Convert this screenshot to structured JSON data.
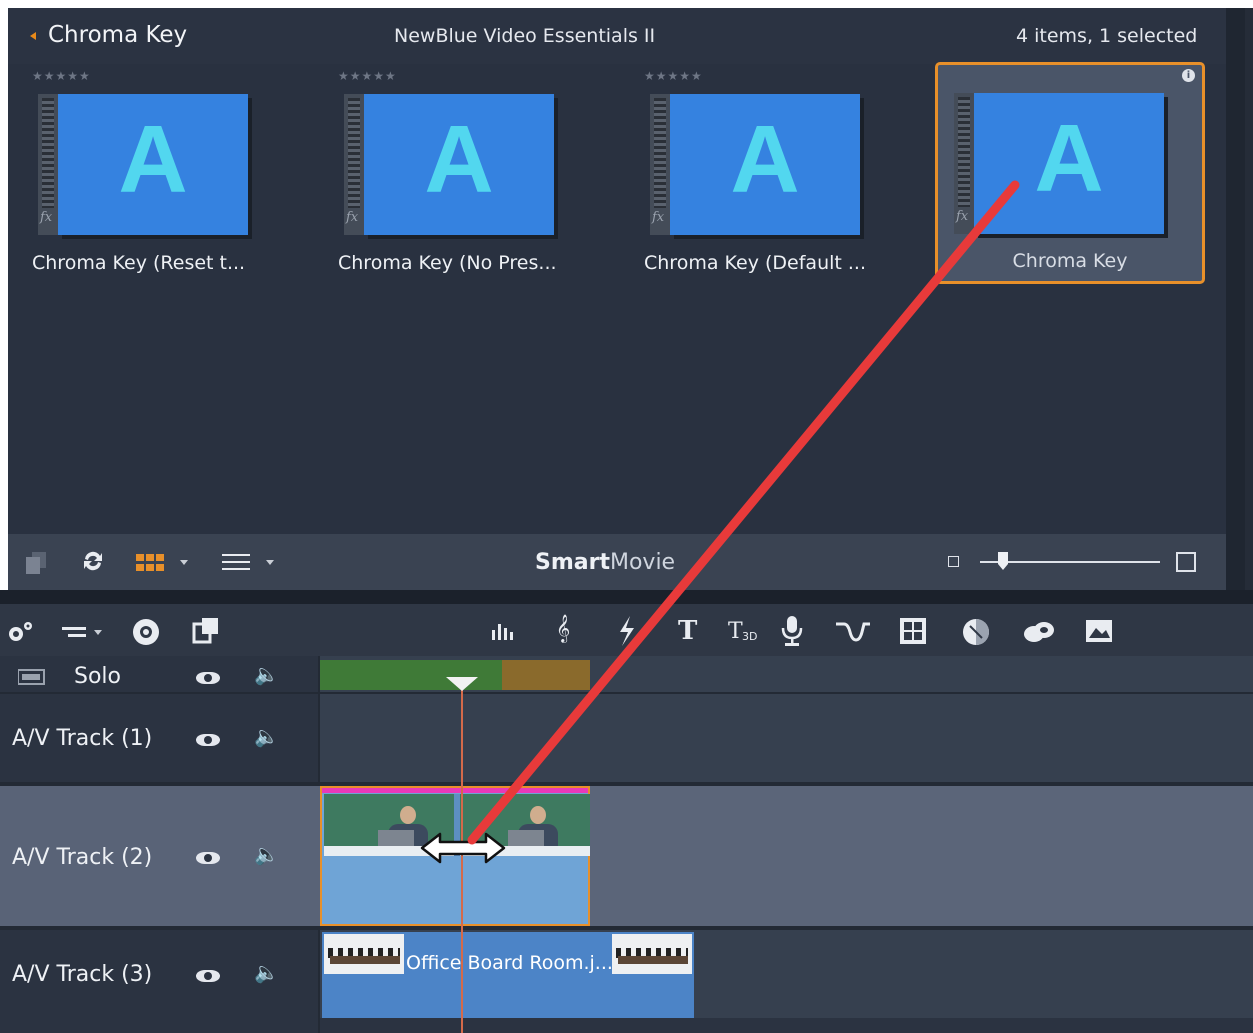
{
  "library": {
    "title": "Chroma Key",
    "category": "NewBlue Video Essentials II",
    "count": "4 items, 1 selected",
    "items": [
      {
        "label": "Chroma Key (Reset t...",
        "letter": "A",
        "selected": false
      },
      {
        "label": "Chroma Key (No Pres...",
        "letter": "A",
        "selected": false
      },
      {
        "label": "Chroma Key (Default ...",
        "letter": "A",
        "selected": false
      },
      {
        "label": "Chroma Key",
        "letter": "A",
        "selected": true
      }
    ],
    "stars": "★★★★★",
    "fx": "fx",
    "info": "i"
  },
  "toolbar": {
    "brand_bold": "Smart",
    "brand_light": "Movie"
  },
  "timeline": {
    "solo_label": "Solo",
    "tracks": [
      {
        "label": "A/V Track (1)"
      },
      {
        "label": "A/V Track (2)"
      },
      {
        "label": "A/V Track (3)"
      }
    ],
    "clip3_label": "Office Board Room.j..."
  },
  "colors": {
    "accent": "#e8902a",
    "drag_arrow": "#e83a3a",
    "clip_top": "#e83ab8"
  },
  "icons": [
    "duplicate-icon",
    "sync-icon",
    "grid-view-icon",
    "list-view-icon",
    "zoom-small-icon",
    "zoom-large-icon",
    "settings-icon",
    "track-options-icon",
    "record-icon",
    "overlay-icon",
    "audio-levels-icon",
    "music-icon",
    "split-icon",
    "title-icon",
    "title-alt-icon",
    "microphone-icon",
    "transition-icon",
    "layout-icon",
    "color-icon",
    "effects-icon",
    "image-icon"
  ]
}
